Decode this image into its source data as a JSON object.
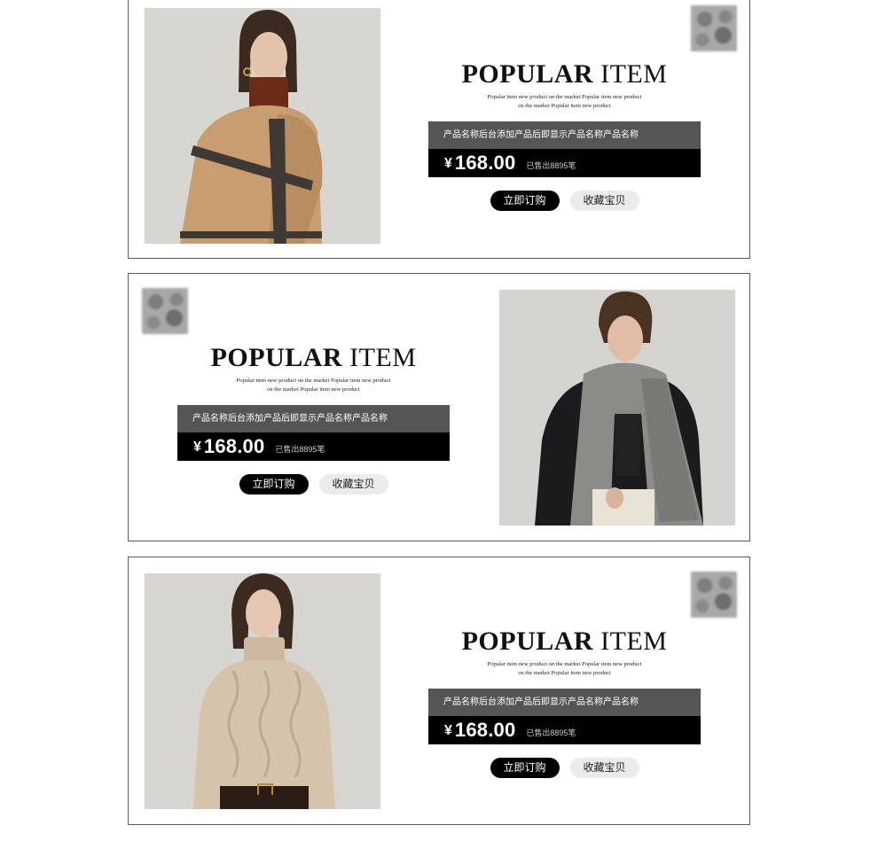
{
  "cards": [
    {
      "headline_bold": "POPULAR",
      "headline_rest": " ITEM",
      "subtext": "Popular item new product on the market Popular item new product on the market Popular item new product",
      "product_name": "产品名称后台添加产品后即显示产品名称产品名称",
      "currency": "¥",
      "price": "168.00",
      "sold": "已售出8895笔",
      "order_label": "立即订购",
      "favorite_label": "收藏宝贝",
      "photo_icon": "model-scarf-camel-photo"
    },
    {
      "headline_bold": "POPULAR",
      "headline_rest": " ITEM",
      "subtext": "Popular item new product on the market Popular item new product on the market Popular item new product",
      "product_name": "产品名称后台添加产品后即显示产品名称产品名称",
      "currency": "¥",
      "price": "168.00",
      "sold": "已售出8895笔",
      "order_label": "立即订购",
      "favorite_label": "收藏宝贝",
      "photo_icon": "model-scarf-grey-photo"
    },
    {
      "headline_bold": "POPULAR",
      "headline_rest": " ITEM",
      "subtext": "Popular item new product on the market Popular item new product on the market Popular item new product",
      "product_name": "产品名称后台添加产品后即显示产品名称产品名称",
      "currency": "¥",
      "price": "168.00",
      "sold": "已售出8895笔",
      "order_label": "立即订购",
      "favorite_label": "收藏宝贝",
      "photo_icon": "model-sweater-photo"
    }
  ],
  "colors": {
    "name_bar": "#555555",
    "price_bar": "#000000",
    "order_button": "#000000",
    "favorite_button": "#ebebeb",
    "photo_background": "#d9d7d2"
  }
}
